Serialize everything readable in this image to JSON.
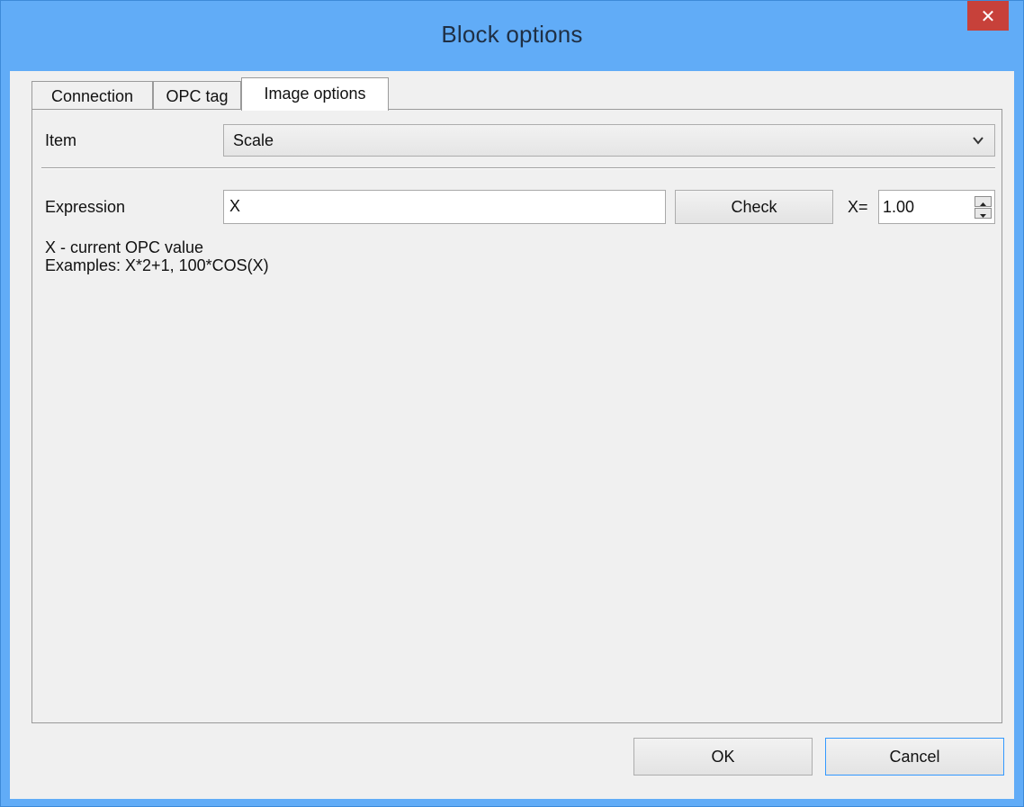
{
  "window": {
    "title": "Block options",
    "close_icon": "close-icon"
  },
  "tabs": [
    {
      "label": "Connection",
      "active": false
    },
    {
      "label": "OPC tag",
      "active": false
    },
    {
      "label": "Image options",
      "active": true
    }
  ],
  "image_options": {
    "item_label": "Item",
    "item_value": "Scale",
    "expression_label": "Expression",
    "expression_value": "X",
    "check_label": "Check",
    "x_label": "X=",
    "x_value": "1.00",
    "hint_line1": "X - current OPC value",
    "hint_line2": "Examples: X*2+1, 100*COS(X)"
  },
  "footer": {
    "ok_label": "OK",
    "cancel_label": "Cancel"
  },
  "colors": {
    "titlebar": "#61acf7",
    "close_button": "#c7413a",
    "default_button_border": "#3399ff"
  }
}
